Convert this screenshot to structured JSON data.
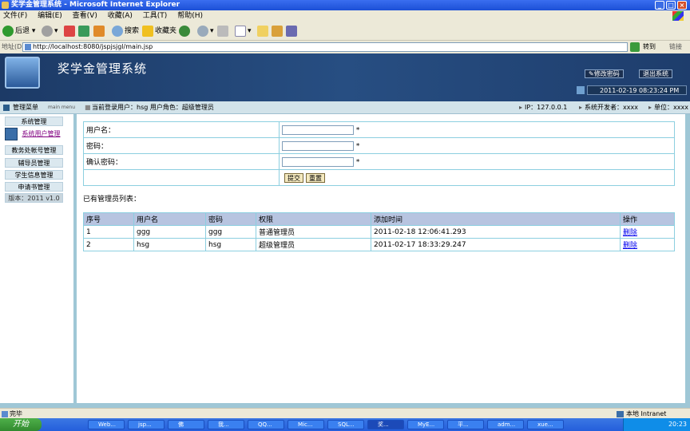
{
  "window": {
    "title": "奖学金管理系统 - Microsoft Internet Explorer"
  },
  "menu": [
    "文件(F)",
    "编辑(E)",
    "查看(V)",
    "收藏(A)",
    "工具(T)",
    "帮助(H)"
  ],
  "toolbar": {
    "back": "后退",
    "search": "搜索",
    "favorites": "收藏夹"
  },
  "address": {
    "label": "地址(D)",
    "url": "http://localhost:8080/jspjsjgl/main.jsp",
    "go": "转到",
    "links": "链接"
  },
  "header": {
    "title": "奖学金管理系统",
    "change_pwd": "修改密码",
    "logout": "退出系统",
    "datetime": "2011-02-19 08:23:24 PM"
  },
  "infobar": {
    "menu_title": "管理菜单",
    "menu_sub": "main menu",
    "current_user": "当前登录用户：hsg  用户角色：超级管理员",
    "ip": "IP：127.0.0.1",
    "developer": "系统开发者：xxxx",
    "unit": "单位：xxxx"
  },
  "sidebar": {
    "items": [
      "系统管理",
      "系统用户管理",
      "教务处帐号管理",
      "辅导员管理",
      "学生信息管理",
      "申请书管理"
    ],
    "version": "版本：2011 v1.0"
  },
  "form": {
    "username_label": "用户名：",
    "password_label": "密码：",
    "confirm_label": "确认密码：",
    "required": "*",
    "submit": "提交",
    "reset": "重置"
  },
  "list": {
    "title": "已有管理员列表：",
    "headers": [
      "序号",
      "用户名",
      "密码",
      "权限",
      "添加时间",
      "操作"
    ],
    "rows": [
      [
        "1",
        "ggg",
        "ggg",
        "普通管理员",
        "2011-02-18 12:06:41.293",
        "删除"
      ],
      [
        "2",
        "hsg",
        "hsg",
        "超级管理员",
        "2011-02-17 18:33:29.247",
        "删除"
      ]
    ]
  },
  "statusbar": {
    "left": "完毕",
    "zone": "本地 Intranet"
  },
  "taskbar": {
    "start": "开始",
    "tasks": [
      "Web...",
      "jsp...",
      "佛",
      "我...",
      "QQ...",
      "Mic...",
      "SQL...",
      "奖...",
      "MyE...",
      "平...",
      "adm...",
      "xue..."
    ],
    "clock": "20:23"
  }
}
